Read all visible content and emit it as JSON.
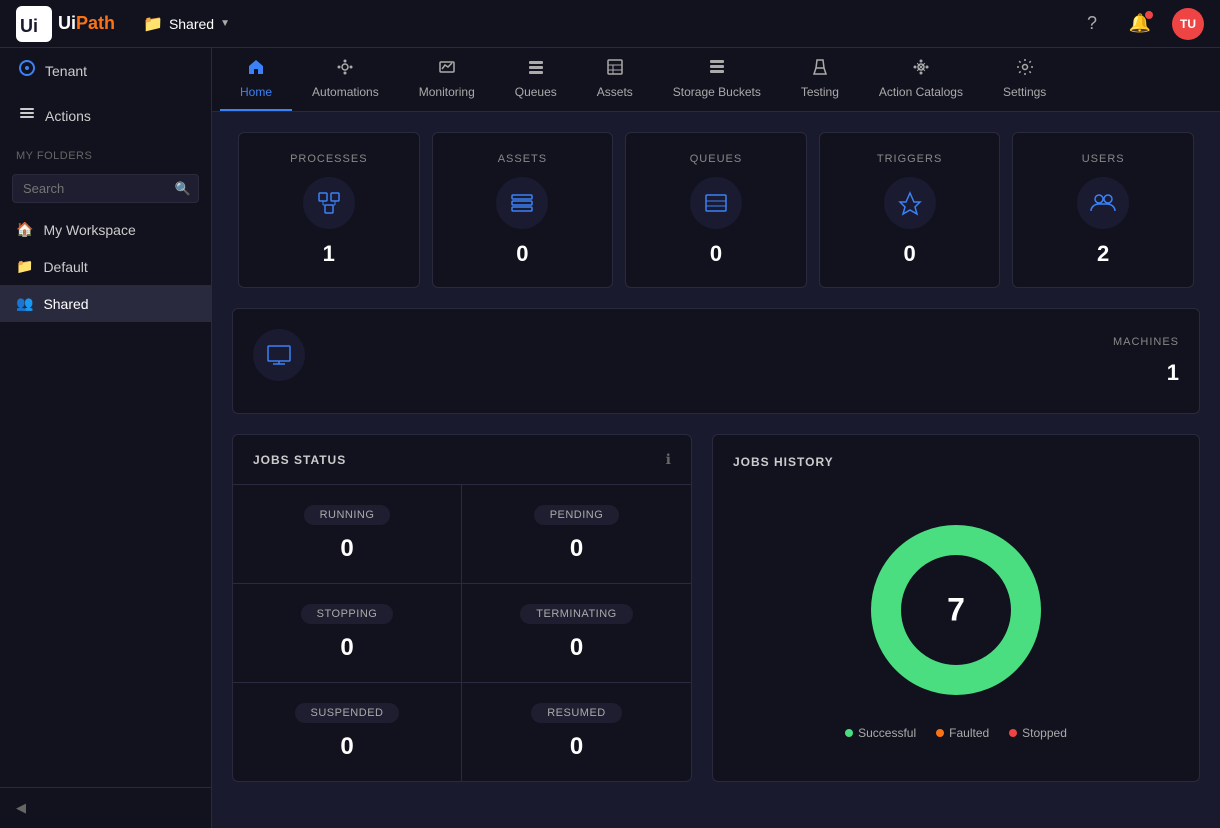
{
  "app": {
    "logo": "UiPath",
    "logo_ui": "Ui",
    "logo_path": "Path"
  },
  "header": {
    "breadcrumb": "Shared",
    "breadcrumb_icon": "📁",
    "help_icon": "?",
    "notification_icon": "🔔",
    "avatar_initials": "TU"
  },
  "sidebar": {
    "tenant_label": "Tenant",
    "actions_label": "Actions",
    "my_folders_label": "MY FOLDERS",
    "search_placeholder": "Search",
    "folders": [
      {
        "name": "My Workspace",
        "icon": "🏠"
      },
      {
        "name": "Default",
        "icon": "📁"
      },
      {
        "name": "Shared",
        "icon": "👥",
        "active": true
      }
    ],
    "collapse_label": "Collapse"
  },
  "nav_tabs": [
    {
      "id": "home",
      "label": "Home",
      "icon": "🏠",
      "active": true
    },
    {
      "id": "automations",
      "label": "Automations",
      "icon": "⚙️"
    },
    {
      "id": "monitoring",
      "label": "Monitoring",
      "icon": "📊"
    },
    {
      "id": "queues",
      "label": "Queues",
      "icon": "📋"
    },
    {
      "id": "assets",
      "label": "Assets",
      "icon": "🗂️"
    },
    {
      "id": "storage-buckets",
      "label": "Storage Buckets",
      "icon": "🗄️"
    },
    {
      "id": "testing",
      "label": "Testing",
      "icon": "🧪"
    },
    {
      "id": "action-catalogs",
      "label": "Action Catalogs",
      "icon": "⚙️"
    },
    {
      "id": "settings",
      "label": "Settings",
      "icon": "⚙️"
    }
  ],
  "stats": [
    {
      "id": "processes",
      "label": "PROCESSES",
      "value": "1",
      "icon": "⬡"
    },
    {
      "id": "assets",
      "label": "ASSETS",
      "value": "0",
      "icon": "☰"
    },
    {
      "id": "queues",
      "label": "QUEUES",
      "value": "0",
      "icon": "☰"
    },
    {
      "id": "triggers",
      "label": "TRIGGERS",
      "value": "0",
      "icon": "⚡"
    },
    {
      "id": "users",
      "label": "USERS",
      "value": "2",
      "icon": "👥"
    }
  ],
  "machines": {
    "label": "MACHINES",
    "value": "1",
    "icon": "🖥️"
  },
  "jobs_status": {
    "title": "JOBS STATUS",
    "items": [
      {
        "id": "running",
        "label": "RUNNING",
        "value": "0"
      },
      {
        "id": "pending",
        "label": "PENDING",
        "value": "0"
      },
      {
        "id": "stopping",
        "label": "STOPPING",
        "value": "0"
      },
      {
        "id": "terminating",
        "label": "TERMINATING",
        "value": "0"
      },
      {
        "id": "suspended",
        "label": "SUSPENDED",
        "value": "0"
      },
      {
        "id": "resumed",
        "label": "RESUMED",
        "value": "0"
      }
    ]
  },
  "jobs_history": {
    "title": "JOBS HISTORY",
    "total": "7",
    "legend": [
      {
        "label": "Successful",
        "color": "#4ade80"
      },
      {
        "label": "Faulted",
        "color": "#f97316"
      },
      {
        "label": "Stopped",
        "color": "#ef4444"
      }
    ],
    "donut_color": "#4ade80",
    "donut_bg": "#1e1e30"
  },
  "colors": {
    "accent": "#3b82f6",
    "success": "#4ade80",
    "danger": "#ef4444",
    "warning": "#f97316",
    "sidebar_bg": "#12121f",
    "card_bg": "#12121f",
    "body_bg": "#1a1a2e",
    "border": "#2a2a3e",
    "icon_blue": "#3b82f6"
  }
}
